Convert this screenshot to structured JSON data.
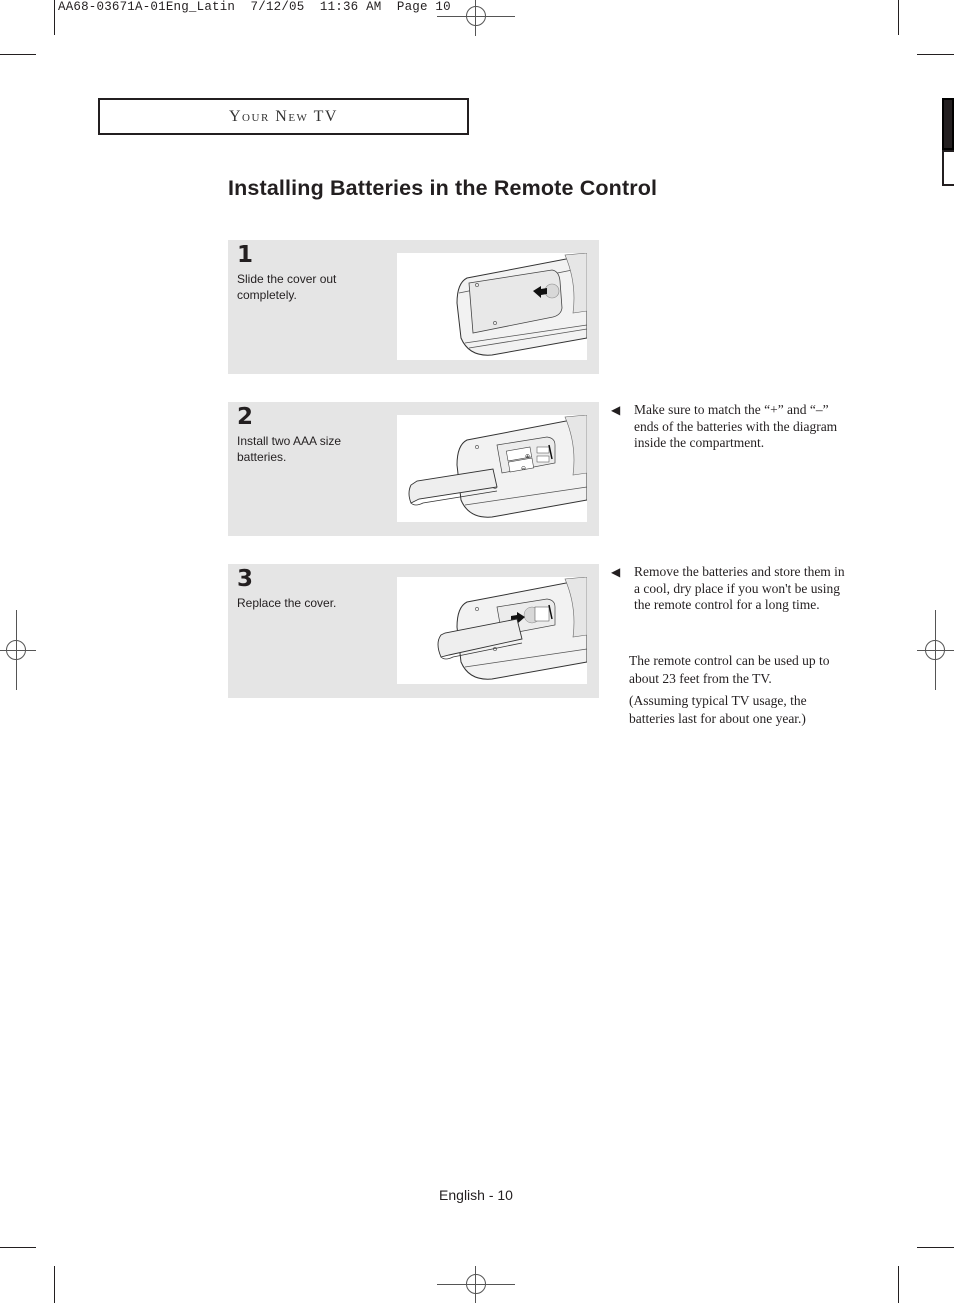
{
  "print_slug": {
    "job": "AA68-03671A-01Eng_Latin",
    "date": "7/12/05",
    "time": "11:36 AM",
    "page": "Page 10"
  },
  "section_header": "Your New TV",
  "page_title": "Installing Batteries in the Remote Control",
  "steps": [
    {
      "number": "1",
      "text": "Slide the cover out completely.",
      "illustration": "remote-cover-slide-out"
    },
    {
      "number": "2",
      "text": "Install two AAA size batteries.",
      "illustration": "remote-batteries-install"
    },
    {
      "number": "3",
      "text": "Replace the cover.",
      "illustration": "remote-cover-replace"
    }
  ],
  "notes": [
    {
      "icon": "triangle-left-bullet",
      "text": "Make sure to match the “+” and “–” ends of the batteries with the diagram inside the compartment."
    },
    {
      "icon": "triangle-left-bullet",
      "text": "Remove the batteries and store them in a cool, dry place if you won't be using the remote control for a long time."
    }
  ],
  "paragraphs": [
    "The remote control can be used up to about 23 feet from the TV.",
    "(Assuming typical TV usage, the batteries last for about one year.)"
  ],
  "footer": "English - 10"
}
